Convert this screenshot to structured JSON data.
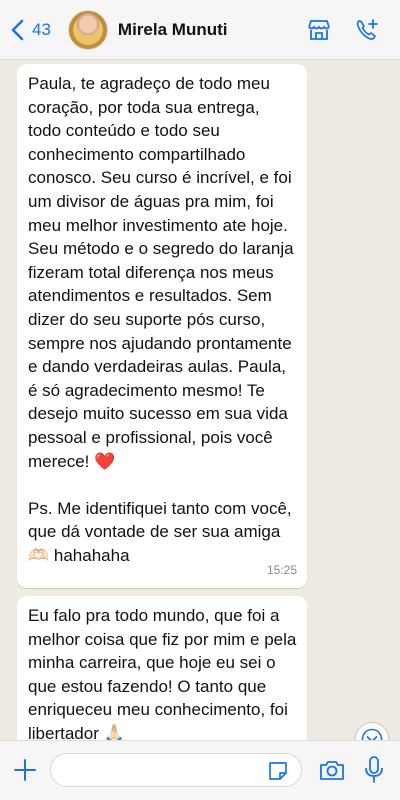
{
  "header": {
    "back_count": "43",
    "contact_name": "Mirela Munuti",
    "icons": [
      "chevron-left-icon",
      "store-icon",
      "phone-plus-icon"
    ]
  },
  "messages": [
    {
      "text": "Paula, te agradeço de todo meu coração, por toda sua entrega, todo conteúdo e todo seu conhecimento compartilhado conosco. Seu curso é incrível, e foi um divisor de águas pra mim, foi meu melhor investimento ate hoje.  Seu método e o segredo do laranja fizeram total diferença nos meus atendimentos e resultados. Sem dizer do seu suporte pós curso, sempre nos ajudando prontamente e dando verdadeiras aulas. Paula, é só agradecimento mesmo! Te desejo muito sucesso em sua vida pessoal e profissional, pois você merece! ❤️\n\nPs. Me identifiquei tanto com você, que dá vontade de ser sua amiga 🫶🏻 hahahaha",
      "time": "15:25"
    },
    {
      "text": "Eu falo pra todo mundo, que foi a melhor coisa que fiz por mim e pela minha carreira, que hoje eu sei o que estou fazendo! O tanto que enriqueceu meu conhecimento, foi libertador 🙏🏻",
      "time": ""
    }
  ],
  "input": {
    "value": "",
    "placeholder": ""
  },
  "colors": {
    "accent": "#1a74e8",
    "chat_bg": "#efeae2",
    "bubble_bg": "#ffffff"
  }
}
